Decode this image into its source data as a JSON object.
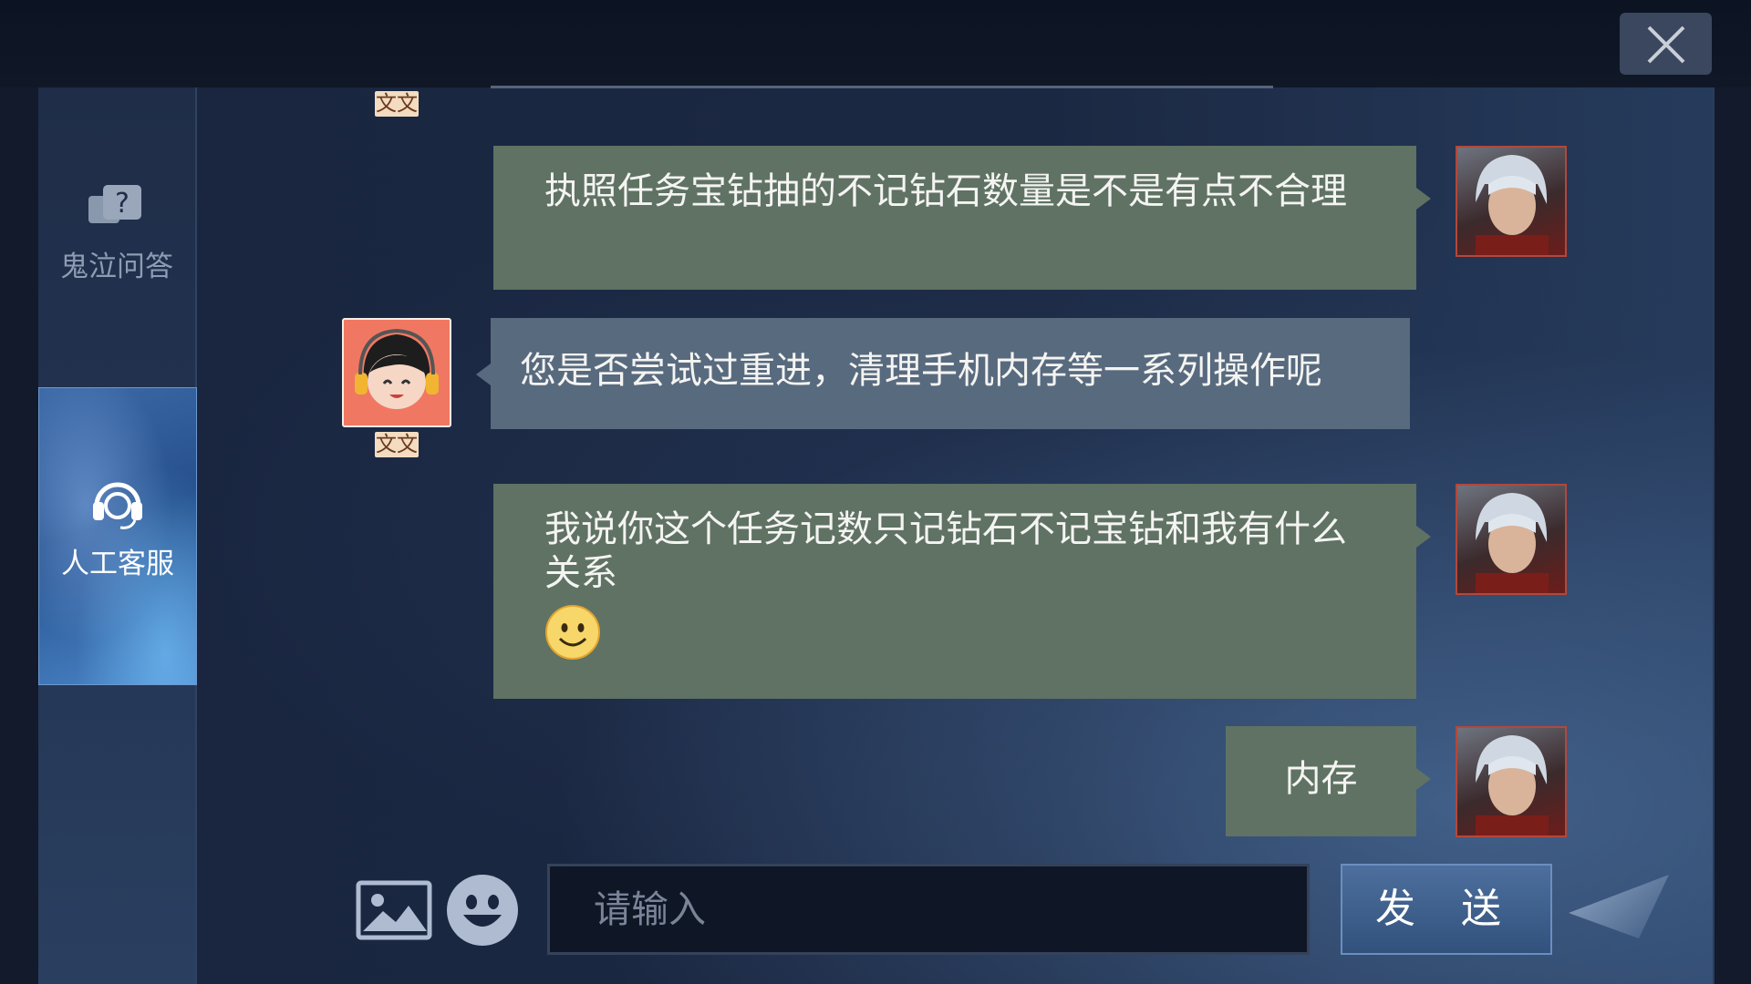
{
  "sidebar": {
    "items": [
      {
        "label": "鬼泣问答",
        "icon": "help-bubble-icon"
      },
      {
        "label": "人工客服",
        "icon": "headset-icon",
        "active": true
      }
    ]
  },
  "chat": {
    "messages": [
      {
        "from": "user",
        "text": "执照任务宝钻抽的不记钻石数量是不是有点不合理"
      },
      {
        "from": "agent",
        "name": "文文",
        "text": "您是否尝试过重进，清理手机内存等一系列操作呢"
      },
      {
        "from": "user",
        "text": "我说你这个任务记数只记钻石不记宝钻和我有什么关系",
        "emoji": "smile-emoji-icon"
      },
      {
        "from": "user",
        "text": "内存"
      }
    ],
    "top_agent_name": "文文"
  },
  "composer": {
    "placeholder": "请输入",
    "send_label": "发 送",
    "image_icon": "image-icon",
    "emoji_icon": "emoji-icon"
  },
  "colors": {
    "user_bubble": "#5f7263",
    "agent_bubble": "#586a7e",
    "send_button": "#3f6190"
  }
}
